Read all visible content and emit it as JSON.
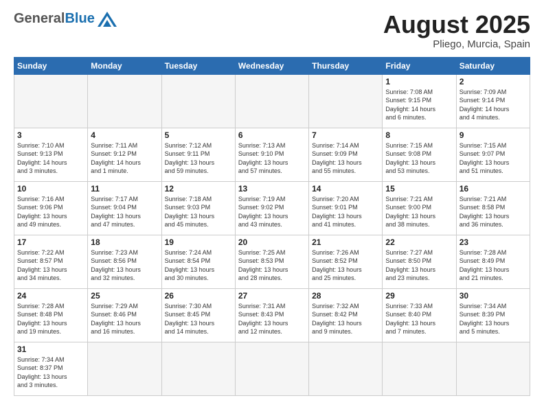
{
  "logo": {
    "general": "General",
    "blue": "Blue"
  },
  "title": "August 2025",
  "location": "Pliego, Murcia, Spain",
  "weekdays": [
    "Sunday",
    "Monday",
    "Tuesday",
    "Wednesday",
    "Thursday",
    "Friday",
    "Saturday"
  ],
  "days": {
    "1": {
      "sunrise": "7:08 AM",
      "sunset": "9:15 PM",
      "daylight": "14 hours and 6 minutes."
    },
    "2": {
      "sunrise": "7:09 AM",
      "sunset": "9:14 PM",
      "daylight": "14 hours and 4 minutes."
    },
    "3": {
      "sunrise": "7:10 AM",
      "sunset": "9:13 PM",
      "daylight": "14 hours and 3 minutes."
    },
    "4": {
      "sunrise": "7:11 AM",
      "sunset": "9:12 PM",
      "daylight": "14 hours and 1 minute."
    },
    "5": {
      "sunrise": "7:12 AM",
      "sunset": "9:11 PM",
      "daylight": "13 hours and 59 minutes."
    },
    "6": {
      "sunrise": "7:13 AM",
      "sunset": "9:10 PM",
      "daylight": "13 hours and 57 minutes."
    },
    "7": {
      "sunrise": "7:14 AM",
      "sunset": "9:09 PM",
      "daylight": "13 hours and 55 minutes."
    },
    "8": {
      "sunrise": "7:15 AM",
      "sunset": "9:08 PM",
      "daylight": "13 hours and 53 minutes."
    },
    "9": {
      "sunrise": "7:15 AM",
      "sunset": "9:07 PM",
      "daylight": "13 hours and 51 minutes."
    },
    "10": {
      "sunrise": "7:16 AM",
      "sunset": "9:06 PM",
      "daylight": "13 hours and 49 minutes."
    },
    "11": {
      "sunrise": "7:17 AM",
      "sunset": "9:04 PM",
      "daylight": "13 hours and 47 minutes."
    },
    "12": {
      "sunrise": "7:18 AM",
      "sunset": "9:03 PM",
      "daylight": "13 hours and 45 minutes."
    },
    "13": {
      "sunrise": "7:19 AM",
      "sunset": "9:02 PM",
      "daylight": "13 hours and 43 minutes."
    },
    "14": {
      "sunrise": "7:20 AM",
      "sunset": "9:01 PM",
      "daylight": "13 hours and 41 minutes."
    },
    "15": {
      "sunrise": "7:21 AM",
      "sunset": "9:00 PM",
      "daylight": "13 hours and 38 minutes."
    },
    "16": {
      "sunrise": "7:21 AM",
      "sunset": "8:58 PM",
      "daylight": "13 hours and 36 minutes."
    },
    "17": {
      "sunrise": "7:22 AM",
      "sunset": "8:57 PM",
      "daylight": "13 hours and 34 minutes."
    },
    "18": {
      "sunrise": "7:23 AM",
      "sunset": "8:56 PM",
      "daylight": "13 hours and 32 minutes."
    },
    "19": {
      "sunrise": "7:24 AM",
      "sunset": "8:54 PM",
      "daylight": "13 hours and 30 minutes."
    },
    "20": {
      "sunrise": "7:25 AM",
      "sunset": "8:53 PM",
      "daylight": "13 hours and 28 minutes."
    },
    "21": {
      "sunrise": "7:26 AM",
      "sunset": "8:52 PM",
      "daylight": "13 hours and 25 minutes."
    },
    "22": {
      "sunrise": "7:27 AM",
      "sunset": "8:50 PM",
      "daylight": "13 hours and 23 minutes."
    },
    "23": {
      "sunrise": "7:28 AM",
      "sunset": "8:49 PM",
      "daylight": "13 hours and 21 minutes."
    },
    "24": {
      "sunrise": "7:28 AM",
      "sunset": "8:48 PM",
      "daylight": "13 hours and 19 minutes."
    },
    "25": {
      "sunrise": "7:29 AM",
      "sunset": "8:46 PM",
      "daylight": "13 hours and 16 minutes."
    },
    "26": {
      "sunrise": "7:30 AM",
      "sunset": "8:45 PM",
      "daylight": "13 hours and 14 minutes."
    },
    "27": {
      "sunrise": "7:31 AM",
      "sunset": "8:43 PM",
      "daylight": "13 hours and 12 minutes."
    },
    "28": {
      "sunrise": "7:32 AM",
      "sunset": "8:42 PM",
      "daylight": "13 hours and 9 minutes."
    },
    "29": {
      "sunrise": "7:33 AM",
      "sunset": "8:40 PM",
      "daylight": "13 hours and 7 minutes."
    },
    "30": {
      "sunrise": "7:34 AM",
      "sunset": "8:39 PM",
      "daylight": "13 hours and 5 minutes."
    },
    "31": {
      "sunrise": "7:34 AM",
      "sunset": "8:37 PM",
      "daylight": "13 hours and 3 minutes."
    }
  }
}
